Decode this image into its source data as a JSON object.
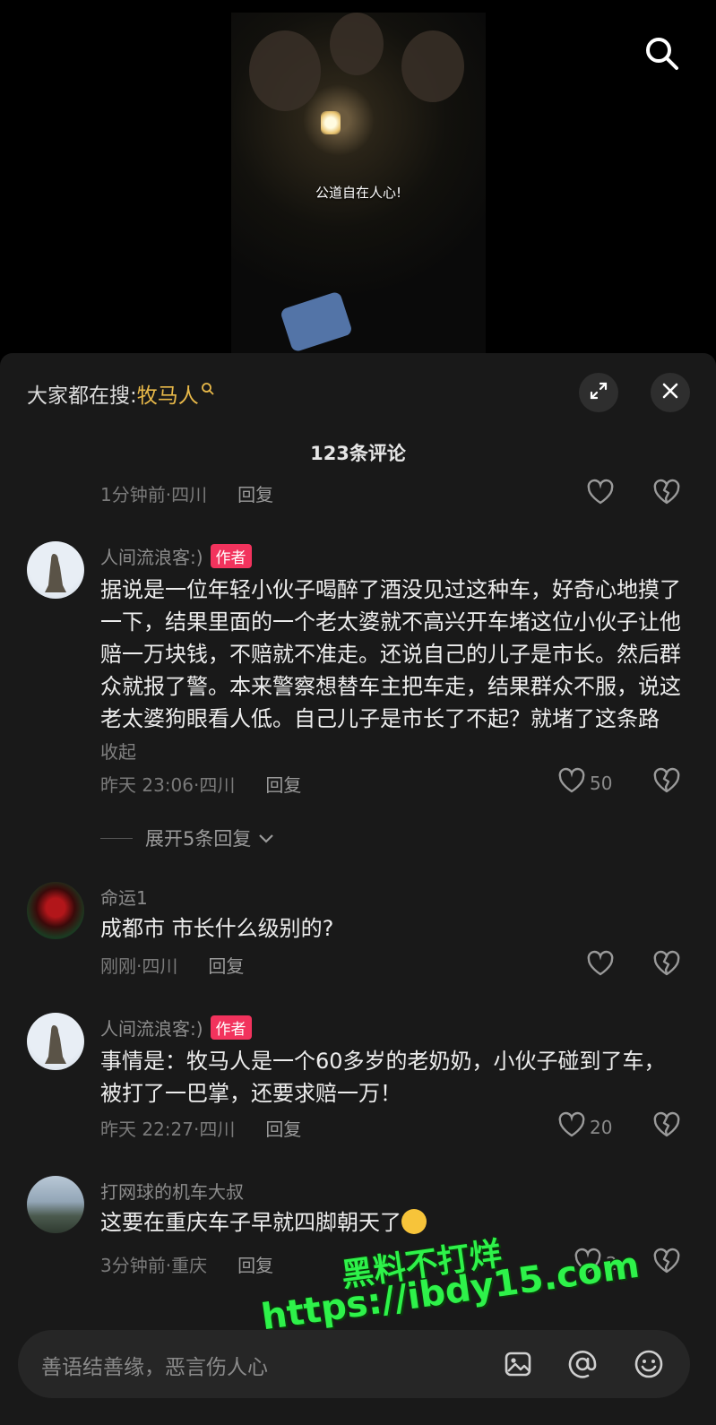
{
  "video": {
    "caption": "公道自在人心!"
  },
  "header": {
    "hot_prefix": "大家都在搜:",
    "hot_keyword": "牧马人",
    "comment_count": "123条评论"
  },
  "first_meta": {
    "time_loc": "1分钟前·四川",
    "reply": "回复"
  },
  "comments": [
    {
      "user": "人间流浪客:)",
      "tag": "作者",
      "text": "据说是一位年轻小伙子喝醉了酒没见过这种车，好奇心地摸了一下，结果里面的一个老太婆就不高兴开车堵这位小伙子让他赔一万块钱，不赔就不准走。还说自己的儿子是市长。然后群众就报了警。本来警察想替车主把车走，结果群众不服，说这老太婆狗眼看人低。自己儿子是市长了不起？就堵了这条路",
      "fold": "收起",
      "time_loc": "昨天 23:06·四川",
      "reply": "回复",
      "likes": "50"
    },
    {
      "user": "命运1",
      "tag": "",
      "text": "成都市 市长什么级别的?",
      "time_loc": "刚刚·四川",
      "reply": "回复",
      "likes": ""
    },
    {
      "user": "人间流浪客:)",
      "tag": "作者",
      "text": "事情是：牧马人是一个60多岁的老奶奶，小伙子碰到了车，被打了一巴掌，还要求赔一万！",
      "time_loc": "昨天 22:27·四川",
      "reply": "回复",
      "likes": "20"
    },
    {
      "user": "打网球的机车大叔",
      "tag": "",
      "text": "这要在重庆车子早就四脚朝天了",
      "time_loc": "3分钟前·重庆",
      "reply": "回复",
      "likes": "2"
    }
  ],
  "expand_replies": "展开5条回复",
  "input": {
    "placeholder": "善语结善缘，恶言伤人心"
  },
  "watermark": {
    "line1": "黑料不打烊",
    "line2": "https://ibdy15.com"
  },
  "icons": [
    "search-icon",
    "expand-icon",
    "close-icon",
    "heart-icon",
    "broken-heart-icon",
    "chevron-down-icon",
    "image-icon",
    "at-icon",
    "smiley-icon"
  ],
  "colors": {
    "accent_keyword": "#e9b949",
    "author_tag": "#f2335d",
    "watermark": "#2ef24a"
  }
}
